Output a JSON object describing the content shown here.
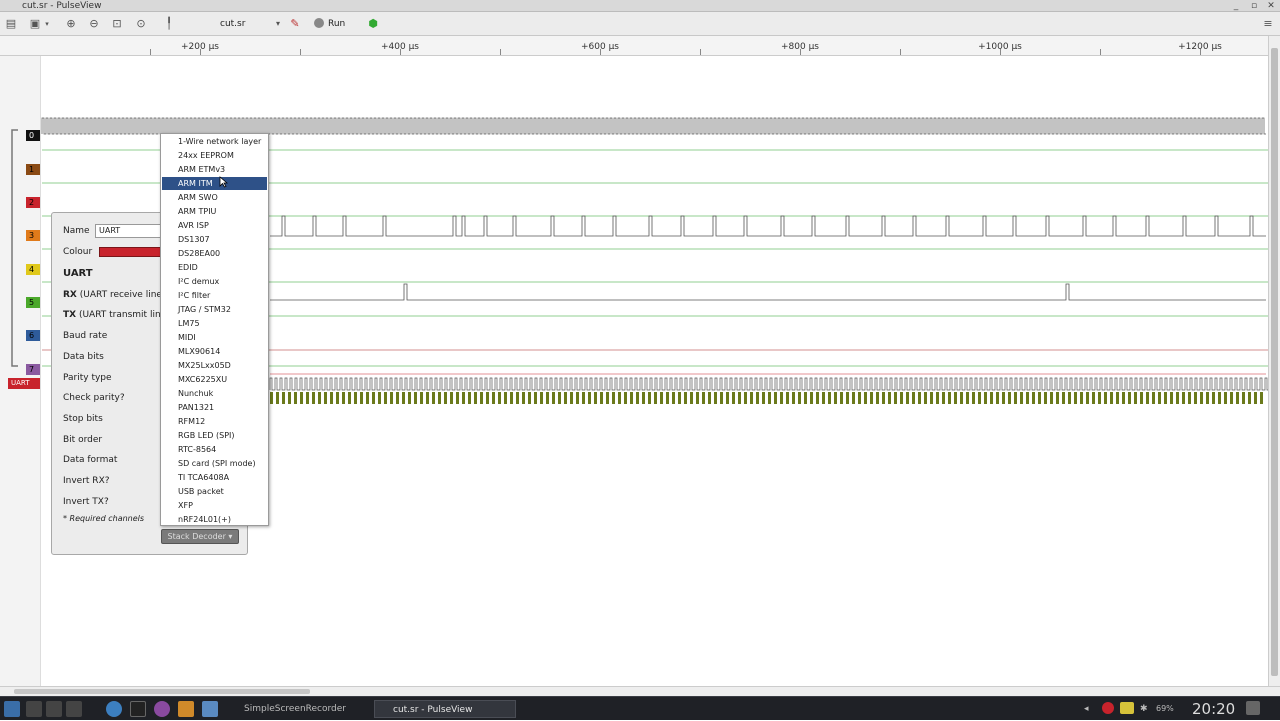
{
  "window": {
    "title": "cut.sr - PulseView",
    "controls": [
      "_",
      "▫",
      "✕"
    ]
  },
  "toolbar": {
    "file_name": "cut.sr",
    "run_label": "Run"
  },
  "ruler": {
    "labels": [
      "+200 µs",
      "+400 µs",
      "+600 µs",
      "+800 µs",
      "+1000 µs",
      "+1200 µs"
    ]
  },
  "channels": {
    "labels": [
      "0",
      "1",
      "2",
      "3",
      "4",
      "5",
      "6",
      "7"
    ],
    "decoder_label": "UART"
  },
  "decoder_dialog": {
    "name_label": "Name",
    "name_value": "UART",
    "colour_label": "Colour",
    "colour": "#c8232c",
    "section_title": "UART",
    "options": [
      {
        "bold": "RX",
        "rest": " (UART receive line)"
      },
      {
        "bold": "TX",
        "rest": " (UART transmit line)"
      },
      {
        "bold": "",
        "rest": "Baud rate"
      },
      {
        "bold": "",
        "rest": "Data bits"
      },
      {
        "bold": "",
        "rest": "Parity type"
      },
      {
        "bold": "",
        "rest": "Check parity?"
      },
      {
        "bold": "",
        "rest": "Stop bits"
      },
      {
        "bold": "",
        "rest": "Bit order"
      },
      {
        "bold": "",
        "rest": "Data format"
      },
      {
        "bold": "",
        "rest": "Invert RX?"
      },
      {
        "bold": "",
        "rest": "Invert TX?"
      }
    ],
    "required_note": "* Required channels",
    "stack_button": "Stack Decoder"
  },
  "decoder_menu": {
    "selected_index": 3,
    "items": [
      "1-Wire network layer",
      "24xx EEPROM",
      "ARM ETMv3",
      "ARM ITM",
      "ARM SWO",
      "ARM TPIU",
      "AVR ISP",
      "DS1307",
      "DS28EA00",
      "EDID",
      "I²C demux",
      "I²C filter",
      "JTAG / STM32",
      "LM75",
      "MIDI",
      "MLX90614",
      "MX25Lxx05D",
      "MXC6225XU",
      "Nunchuk",
      "PAN1321",
      "RFM12",
      "RGB LED (SPI)",
      "RTC-8564",
      "SD card (SPI mode)",
      "TI TCA6408A",
      "USB packet",
      "XFP",
      "nRF24L01(+)"
    ]
  },
  "taskbar": {
    "items": [
      "SimpleScreenRecorder",
      "cut.sr - PulseView"
    ],
    "battery": "69%",
    "clock": "20:20"
  },
  "colors": {
    "accent": "#2e5188",
    "trace": "#3a9a3a",
    "uart_row": "#6b7a1c",
    "decoder": "#c8232c"
  }
}
